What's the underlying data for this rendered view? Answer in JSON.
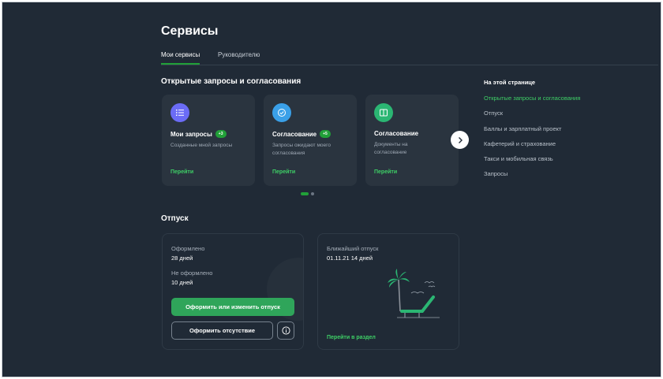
{
  "page": {
    "title": "Сервисы"
  },
  "tabs": [
    {
      "label": "Мои сервисы",
      "active": true
    },
    {
      "label": "Руководителю",
      "active": false
    }
  ],
  "requests_section": {
    "title": "Открытые запросы и согласования",
    "cards": [
      {
        "icon": "list-icon",
        "icon_color": "#6b6cf6",
        "title": "Мои запросы",
        "badge": "+3",
        "description": "Созданные мной запросы",
        "link": "Перейти"
      },
      {
        "icon": "check-circle-icon",
        "icon_color": "#3aa0e8",
        "title": "Согласование",
        "badge": "+5",
        "description": "Запросы ожидают моего согласования",
        "link": "Перейти"
      },
      {
        "icon": "book-icon",
        "icon_color": "#2bb673",
        "title": "Согласование",
        "badge": "",
        "description": "Документы на согласование",
        "link": "Перейти"
      }
    ]
  },
  "toc": {
    "heading": "На этой странице",
    "items": [
      {
        "label": "Открытые запросы и согласования",
        "active": true
      },
      {
        "label": "Отпуск",
        "active": false
      },
      {
        "label": "Баллы и зарплатный проект",
        "active": false
      },
      {
        "label": "Кафетерий и страхование",
        "active": false
      },
      {
        "label": "Такси и мобильная связь",
        "active": false
      },
      {
        "label": "Запросы",
        "active": false
      }
    ]
  },
  "vacation": {
    "title": "Отпуск",
    "issued_label": "Оформлено",
    "issued_value": "28 дней",
    "not_issued_label": "Не оформлено",
    "not_issued_value": "10 дней",
    "primary_button": "Оформить или изменить отпуск",
    "secondary_button": "Оформить отсутствие",
    "next_label": "Ближайший отпуск",
    "next_value": "01.11.21 14 дней",
    "next_link": "Перейти в раздел"
  },
  "colors": {
    "accent": "#21a038",
    "background": "#202a36",
    "card": "#2a343f"
  }
}
